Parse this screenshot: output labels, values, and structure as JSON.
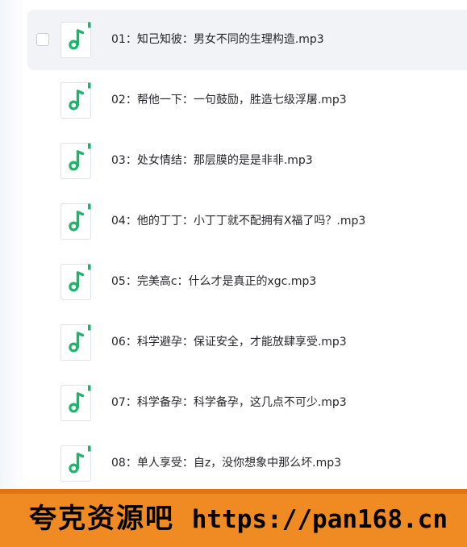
{
  "file_list": {
    "items": [
      {
        "name": "01：知己知彼：男女不同的生理构造.mp3"
      },
      {
        "name": "02：帮他一下：一句鼓励，胜造七级浮屠.mp3"
      },
      {
        "name": "03：处女情结：那层膜的是是非非.mp3"
      },
      {
        "name": "04：他的丁丁：小丁丁就不配拥有X福了吗？.mp3"
      },
      {
        "name": "05：完美高c：什么才是真正的xgc.mp3"
      },
      {
        "name": "06：科学避孕：保证安全，才能放肆享受.mp3"
      },
      {
        "name": "07：科学备孕：科学备孕，这几点不可少.mp3"
      },
      {
        "name": "08：单人享受：自z，没你想象中那么坏.mp3"
      }
    ],
    "file_icon": "audio-file-icon"
  },
  "watermark": {
    "site_name": "夸克资源吧",
    "url": "https://pan168.cn"
  },
  "colors": {
    "icon_green": "#1fb36b",
    "banner_orange": "#f08a22",
    "text": "#25262b"
  }
}
